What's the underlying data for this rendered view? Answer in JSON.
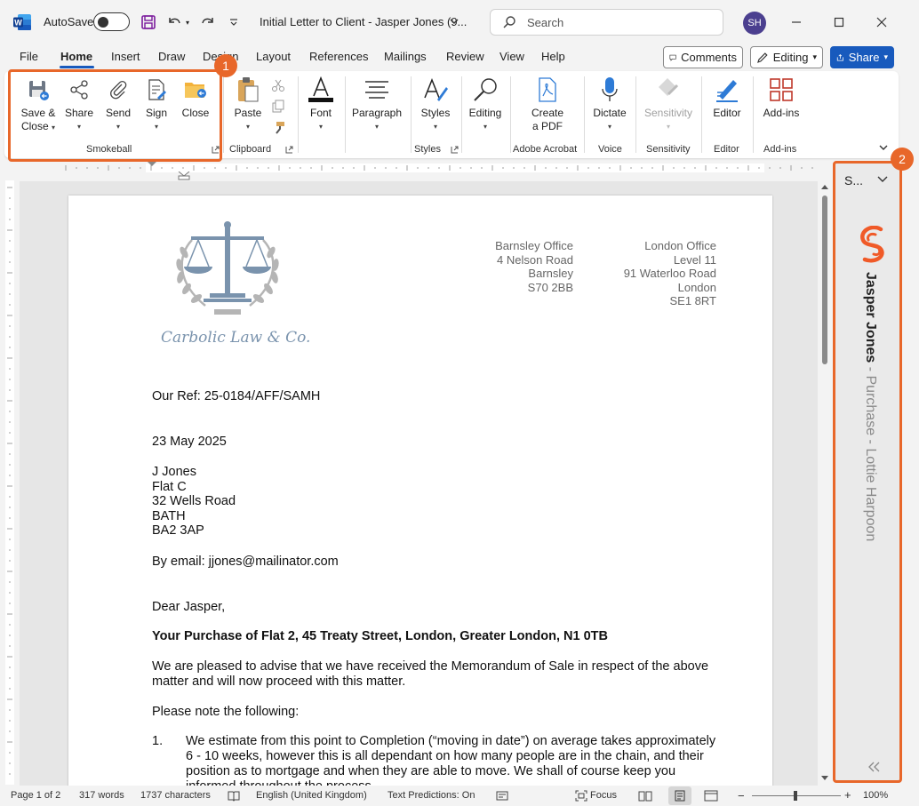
{
  "titlebar": {
    "autosave_label": "AutoSave",
    "doc_title": "Initial Letter to Client - Jasper Jones (9...",
    "search_placeholder": "Search",
    "avatar_initials": "SH"
  },
  "tabs": [
    "File",
    "Home",
    "Insert",
    "Draw",
    "Design",
    "Layout",
    "References",
    "Mailings",
    "Review",
    "View",
    "Help"
  ],
  "header_buttons": {
    "comments": "Comments",
    "editing": "Editing",
    "share": "Share"
  },
  "ribbon": {
    "smokeball": {
      "save_close_1": "Save &",
      "save_close_2": "Close",
      "share": "Share",
      "send": "Send",
      "sign": "Sign",
      "close": "Close",
      "label": "Smokeball"
    },
    "clipboard": {
      "paste": "Paste",
      "label": "Clipboard"
    },
    "font": {
      "font": "Font"
    },
    "paragraph": {
      "paragraph": "Paragraph"
    },
    "styles": {
      "styles": "Styles",
      "label": "Styles"
    },
    "editing": {
      "editing": "Editing"
    },
    "acrobat": {
      "create_1": "Create",
      "create_2": "a PDF",
      "label": "Adobe Acrobat"
    },
    "voice": {
      "dictate": "Dictate",
      "label": "Voice"
    },
    "sensitivity": {
      "sensitivity": "Sensitivity",
      "label": "Sensitivity"
    },
    "editor": {
      "editor": "Editor",
      "label": "Editor"
    },
    "addins": {
      "addins": "Add-ins",
      "label": "Add-ins"
    }
  },
  "document": {
    "logo_text": "Carbolic Law & Co.",
    "barnsley_office": [
      "Barnsley Office",
      "4 Nelson Road",
      "Barnsley",
      "S70 2BB"
    ],
    "london_office": [
      "London Office",
      "Level 11",
      "91 Waterloo Road",
      "London",
      "SE1 8RT"
    ],
    "our_ref": "Our Ref: 25-0184/AFF/SAMH",
    "date": "23 May 2025",
    "address": [
      "J Jones",
      "Flat C",
      "32 Wells Road",
      "BATH",
      "BA2 3AP"
    ],
    "email": "By email: jjones@mailinator.com",
    "salutation": "Dear Jasper,",
    "subject": "Your Purchase of Flat 2, 45 Treaty Street, London, Greater London, N1 0TB",
    "para1_line1": "We are pleased to advise that we have received the Memorandum of Sale in respect of the above",
    "para1_line2": "matter and will now proceed with this matter.",
    "para2": "Please note the following:",
    "item1_number": "1.",
    "item1_lines": [
      "We estimate from this point to Completion (“moving in date”) on average takes approximately",
      "6 - 10 weeks, however this is all dependant on how many people are in the chain, and their",
      "position as to mortgage and when they are able to move.  We shall of course keep you",
      "informed throughout the process."
    ]
  },
  "sidepane": {
    "title": "S...",
    "client_name": "Jasper Jones",
    "matter": " - Purchase - Lottie Harpoon"
  },
  "annotations": {
    "badge1": "1",
    "badge2": "2"
  },
  "statusbar": {
    "page": "Page 1 of 2",
    "words": "317 words",
    "characters": "1737 characters",
    "language": "English (United Kingdom)",
    "predictions": "Text Predictions: On",
    "focus": "Focus",
    "zoom": "100%"
  },
  "colors": {
    "accent": "#185abd",
    "annotation": "#e8672a",
    "smokeball": "#f05a28"
  }
}
